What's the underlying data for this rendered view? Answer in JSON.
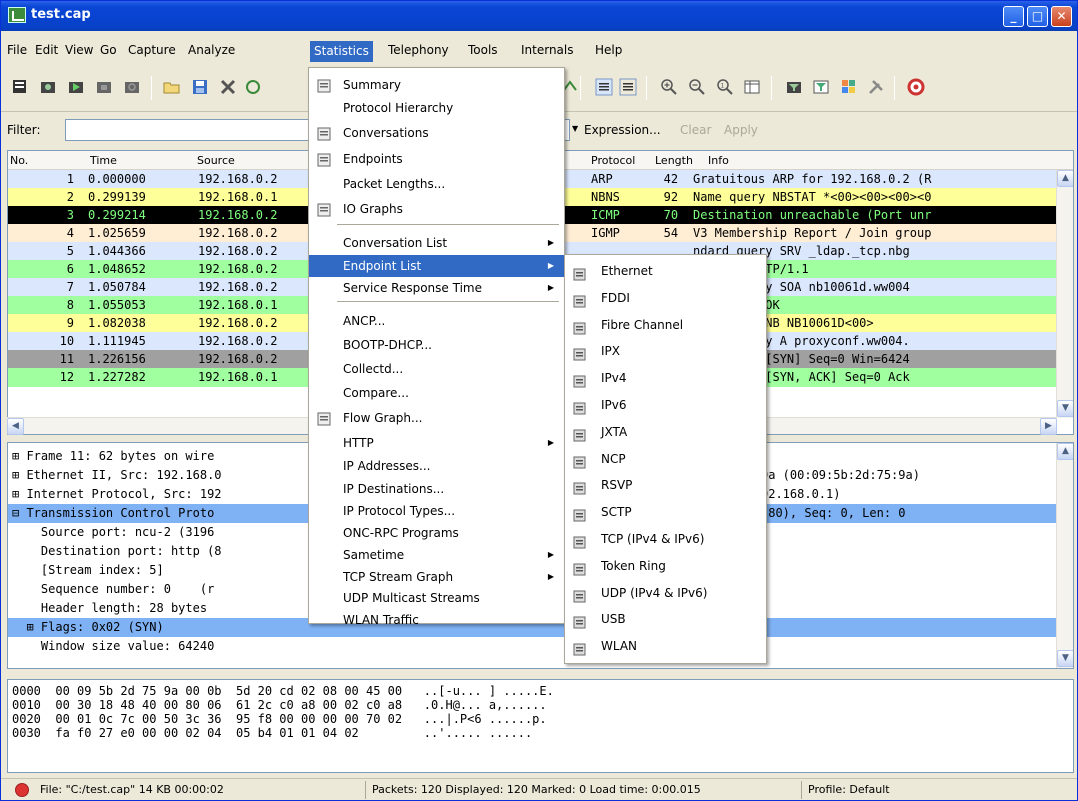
{
  "window": {
    "title": "test.cap"
  },
  "menubar": [
    "File",
    "Edit",
    "View",
    "Go",
    "Capture",
    "Analyze",
    "Statistics",
    "Telephony",
    "Tools",
    "Internals",
    "Help"
  ],
  "filter": {
    "label": "Filter:",
    "expression": "Expression...",
    "clear": "Clear",
    "apply": "Apply"
  },
  "columns": {
    "no": "No.",
    "time": "Time",
    "source": "Source",
    "protocol": "Protocol",
    "length": "Length",
    "info": "Info"
  },
  "packets": [
    {
      "no": "1",
      "time": "0.000000",
      "src": "192.168.0.2",
      "proto": "ARP",
      "len": "42",
      "info": "Gratuitous ARP for 192.168.0.2 (R",
      "bg": "#DAE7FD",
      "fg": "#000000"
    },
    {
      "no": "2",
      "time": "0.299139",
      "src": "192.168.0.1",
      "proto": "NBNS",
      "len": "92",
      "info": "Name query NBSTAT *<00><00><00><0",
      "bg": "#FFFF99",
      "fg": "#000000"
    },
    {
      "no": "3",
      "time": "0.299214",
      "src": "192.168.0.2",
      "proto": "ICMP",
      "len": "70",
      "info": "Destination unreachable (Port unr",
      "bg": "#000000",
      "fg": "#7FFF7F"
    },
    {
      "no": "4",
      "time": "1.025659",
      "src": "192.168.0.2",
      "proto": "IGMP",
      "len": "54",
      "info": "V3 Membership Report / Join group",
      "bg": "#FFEDD4",
      "fg": "#000000"
    },
    {
      "no": "5",
      "time": "1.044366",
      "src": "192.168.0.2",
      "proto": "",
      "len": "",
      "info": "ndard query SRV _ldap._tcp.nbg",
      "bg": "#DAE7FD",
      "fg": "#000000"
    },
    {
      "no": "6",
      "time": "1.048652",
      "src": "192.168.0.2",
      "proto": "",
      "len": "",
      "info": "EARCH * HTTP/1.1",
      "bg": "#A0FF9F",
      "fg": "#000000"
    },
    {
      "no": "7",
      "time": "1.050784",
      "src": "192.168.0.2",
      "proto": "",
      "len": "",
      "info": "ndard query SOA nb10061d.ww004",
      "bg": "#DAE7FD",
      "fg": "#000000"
    },
    {
      "no": "8",
      "time": "1.055053",
      "src": "192.168.0.1",
      "proto": "",
      "len": "",
      "info": "P/1.1 200 OK",
      "bg": "#A0FF9F",
      "fg": "#000000"
    },
    {
      "no": "9",
      "time": "1.082038",
      "src": "192.168.0.2",
      "proto": "",
      "len": "",
      "info": "istration NB NB10061D<00>",
      "bg": "#FFFF99",
      "fg": "#000000"
    },
    {
      "no": "10",
      "time": "1.111945",
      "src": "192.168.0.2",
      "proto": "",
      "len": "",
      "info": "ndard query A proxyconf.ww004.",
      "bg": "#DAE7FD",
      "fg": "#000000"
    },
    {
      "no": "11",
      "time": "1.226156",
      "src": "192.168.0.2",
      "proto": "",
      "len": "",
      "info": "-2 > http [SYN] Seq=0 Win=6424",
      "bg": "#A0A0A0",
      "fg": "#000000"
    },
    {
      "no": "12",
      "time": "1.227282",
      "src": "192.168.0.1",
      "proto": "",
      "len": "",
      "info": "p > ncu-2 [SYN, ACK] Seq=0 Ack",
      "bg": "#A0FF9F",
      "fg": "#000000"
    }
  ],
  "details": [
    {
      "left": "⊞ Frame 11: 62 bytes on wire",
      "right": "",
      "sel": false
    },
    {
      "left": "⊞ Ethernet II, Src: 192.168.0",
      "right": "9a (00:09:5b:2d:75:9a)",
      "sel": false
    },
    {
      "left": "⊞ Internet Protocol, Src: 192",
      "right": "92.168.0.1)",
      "sel": false
    },
    {
      "left": "⊟ Transmission Control Proto",
      "right": "(80), Seq: 0, Len: 0",
      "sel": true
    },
    {
      "left": "    Source port: ncu-2 (3196",
      "right": "",
      "sel": false
    },
    {
      "left": "    Destination port: http (8",
      "right": "",
      "sel": false
    },
    {
      "left": "    [Stream index: 5]",
      "right": "",
      "sel": false
    },
    {
      "left": "    Sequence number: 0    (r",
      "right": "",
      "sel": false
    },
    {
      "left": "    Header length: 28 bytes",
      "right": "",
      "sel": false
    },
    {
      "left": "  ⊞ Flags: 0x02 (SYN)",
      "right": "",
      "sel": true
    },
    {
      "left": "    Window size value: 64240",
      "right": "",
      "sel": false
    }
  ],
  "hex": [
    "0000  00 09 5b 2d 75 9a 00 0b  5d 20 cd 02 08 00 45 00   ..[-u... ] .....E.",
    "0010  00 30 18 48 40 00 80 06  61 2c c0 a8 00 02 c0 a8   .0.H@... a,......",
    "0020  00 01 0c 7c 00 50 3c 36  95 f8 00 00 00 00 70 02   ...|.P<6 ......p.",
    "0030  fa f0 27 e0 00 00 02 04  05 b4 01 01 04 02         ..'..... ......"
  ],
  "statistics_menu": [
    {
      "label": "Summary",
      "icon": "summary-icon"
    },
    {
      "label": "Protocol Hierarchy",
      "icon": ""
    },
    {
      "label": "Conversations",
      "icon": "conversations-icon"
    },
    {
      "label": "Endpoints",
      "icon": "endpoints-icon"
    },
    {
      "label": "Packet Lengths...",
      "icon": ""
    },
    {
      "label": "IO Graphs",
      "icon": "io-graph-icon"
    },
    {
      "label": "Conversation List",
      "icon": "",
      "submenu": true
    },
    {
      "label": "Endpoint List",
      "icon": "",
      "submenu": true,
      "highlighted": true
    },
    {
      "label": "Service Response Time",
      "icon": "",
      "submenu": true
    },
    {
      "label": "ANCP...",
      "icon": ""
    },
    {
      "label": "BOOTP-DHCP...",
      "icon": ""
    },
    {
      "label": "Collectd...",
      "icon": ""
    },
    {
      "label": "Compare...",
      "icon": ""
    },
    {
      "label": "Flow Graph...",
      "icon": "flow-graph-icon"
    },
    {
      "label": "HTTP",
      "icon": "",
      "submenu": true
    },
    {
      "label": "IP Addresses...",
      "icon": ""
    },
    {
      "label": "IP Destinations...",
      "icon": ""
    },
    {
      "label": "IP Protocol Types...",
      "icon": ""
    },
    {
      "label": "ONC-RPC Programs",
      "icon": ""
    },
    {
      "label": "Sametime",
      "icon": "",
      "submenu": true
    },
    {
      "label": "TCP Stream Graph",
      "icon": "",
      "submenu": true
    },
    {
      "label": "UDP Multicast Streams",
      "icon": ""
    },
    {
      "label": "WLAN Traffic",
      "icon": ""
    }
  ],
  "endpoint_submenu": [
    "Ethernet",
    "FDDI",
    "Fibre Channel",
    "IPX",
    "IPv4",
    "IPv6",
    "JXTA",
    "NCP",
    "RSVP",
    "SCTP",
    "TCP (IPv4 & IPv6)",
    "Token Ring",
    "UDP (IPv4 & IPv6)",
    "USB",
    "WLAN"
  ],
  "status": {
    "file": "File: \"C:/test.cap\" 14 KB 00:00:02",
    "packets": "Packets: 120 Displayed: 120 Marked: 0 Load time: 0:00.015",
    "profile": "Profile: Default"
  }
}
